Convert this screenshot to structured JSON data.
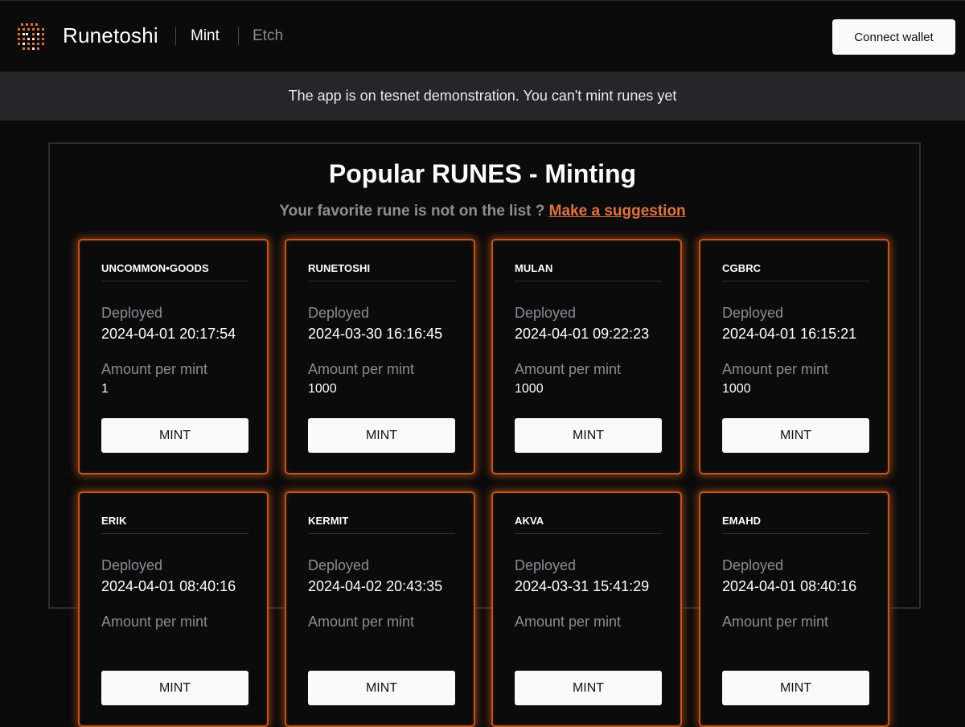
{
  "header": {
    "brand": "Runetoshi",
    "nav": {
      "mint": "Mint",
      "etch": "Etch"
    },
    "connect_label": "Connect wallet",
    "logo_icon": "runetoshi-logo-icon",
    "accent": "#e07340"
  },
  "banner": {
    "text": "The app is on tesnet demonstration. You can't mint runes yet"
  },
  "main": {
    "title": "Popular RUNES - Minting",
    "subtitle": "Your favorite rune is not on the list ?",
    "suggestion_link": "Make a suggestion"
  },
  "card_labels": {
    "deployed": "Deployed",
    "amount": "Amount per mint",
    "mint": "MINT"
  },
  "cards": [
    {
      "name": "UNCOMMON•GOODS",
      "deployed": "2024-04-01 20:17:54",
      "amount": "1"
    },
    {
      "name": "RUNETOSHI",
      "deployed": "2024-03-30 16:16:45",
      "amount": "1000"
    },
    {
      "name": "MULAN",
      "deployed": "2024-04-01 09:22:23",
      "amount": "1000"
    },
    {
      "name": "CGBRC",
      "deployed": "2024-04-01 16:15:21",
      "amount": "1000"
    },
    {
      "name": "ERIK",
      "deployed": "2024-04-01 08:40:16",
      "amount": ""
    },
    {
      "name": "KERMIT",
      "deployed": "2024-04-02 20:43:35",
      "amount": ""
    },
    {
      "name": "AKVA",
      "deployed": "2024-03-31 15:41:29",
      "amount": ""
    },
    {
      "name": "EMAHD",
      "deployed": "2024-04-01 08:40:16",
      "amount": ""
    }
  ]
}
